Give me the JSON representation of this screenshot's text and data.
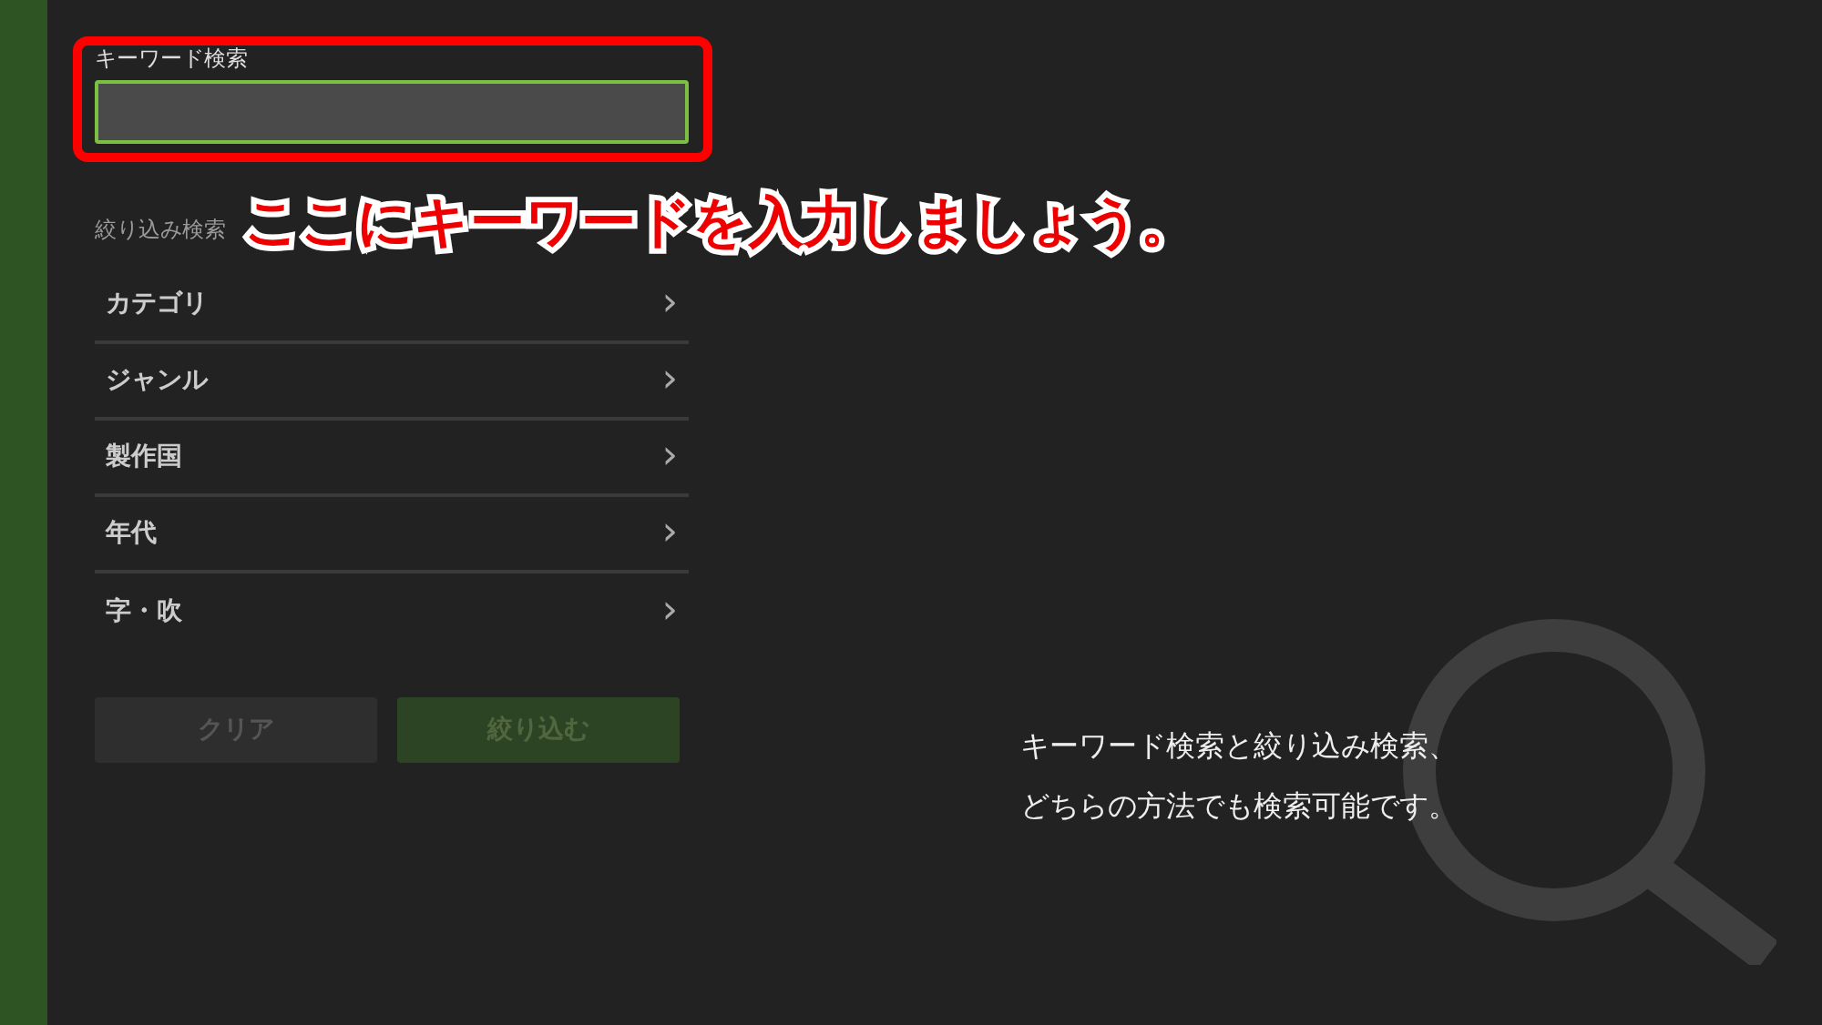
{
  "keyword_search": {
    "label": "キーワード検索"
  },
  "filter": {
    "heading": "絞り込み検索",
    "items": [
      {
        "label": "カテゴリ",
        "chevron": "›"
      },
      {
        "label": "ジャンル",
        "chevron": "›"
      },
      {
        "label": "製作国",
        "chevron": "›"
      },
      {
        "label": "年代",
        "chevron": "›"
      },
      {
        "label": "字・吹",
        "chevron": "›"
      }
    ]
  },
  "buttons": [
    {
      "label": "クリア",
      "kind": "clear",
      "disabled": true
    },
    {
      "label": "絞り込む",
      "kind": "apply",
      "disabled": true
    }
  ],
  "info": {
    "lines": [
      "キーワード検索と絞り込み検索、",
      "どちらの方法でも検索可能です。"
    ]
  },
  "annotation": {
    "text": "ここにキーワードを入力しましょう。"
  }
}
